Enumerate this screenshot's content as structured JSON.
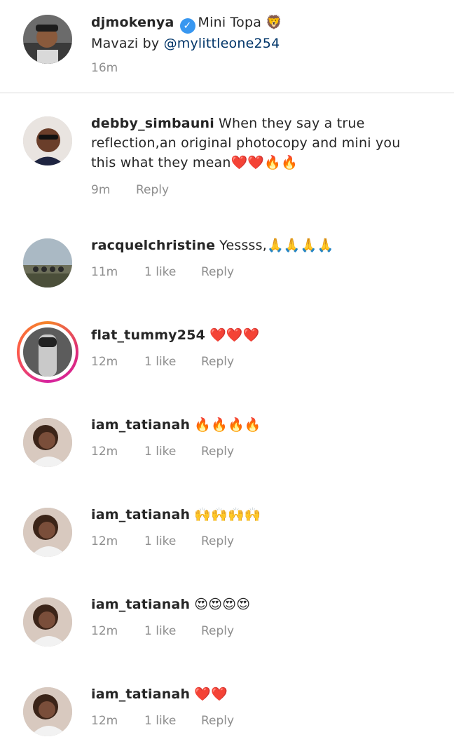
{
  "caption": {
    "username": "djmokenya",
    "text_line1": "Mini Topa 🦁",
    "text_line2_prefix": "Mavazi by ",
    "mention": "@mylittleone254",
    "time": "16m"
  },
  "comments": [
    {
      "username": "debby_simbauni",
      "text": "When they say a true reflection,an original photocopy and mini you this what they mean❤️❤️🔥🔥",
      "time": "9m",
      "likes": "",
      "reply": "Reply"
    },
    {
      "username": "racquelchristine",
      "text": "Yessss,🙏🙏🙏🙏",
      "time": "11m",
      "likes": "1 like",
      "reply": "Reply"
    },
    {
      "username": "flat_tummy254",
      "text": "❤️❤️❤️",
      "time": "12m",
      "likes": "1 like",
      "reply": "Reply"
    },
    {
      "username": "iam_tatianah",
      "text": "🔥🔥🔥🔥",
      "time": "12m",
      "likes": "1 like",
      "reply": "Reply"
    },
    {
      "username": "iam_tatianah",
      "text": "🙌🙌🙌🙌",
      "time": "12m",
      "likes": "1 like",
      "reply": "Reply"
    },
    {
      "username": "iam_tatianah",
      "text": "😍😍😍😍",
      "time": "12m",
      "likes": "1 like",
      "reply": "Reply"
    },
    {
      "username": "iam_tatianah",
      "text": "❤️❤️",
      "time": "12m",
      "likes": "1 like",
      "reply": "Reply"
    }
  ]
}
